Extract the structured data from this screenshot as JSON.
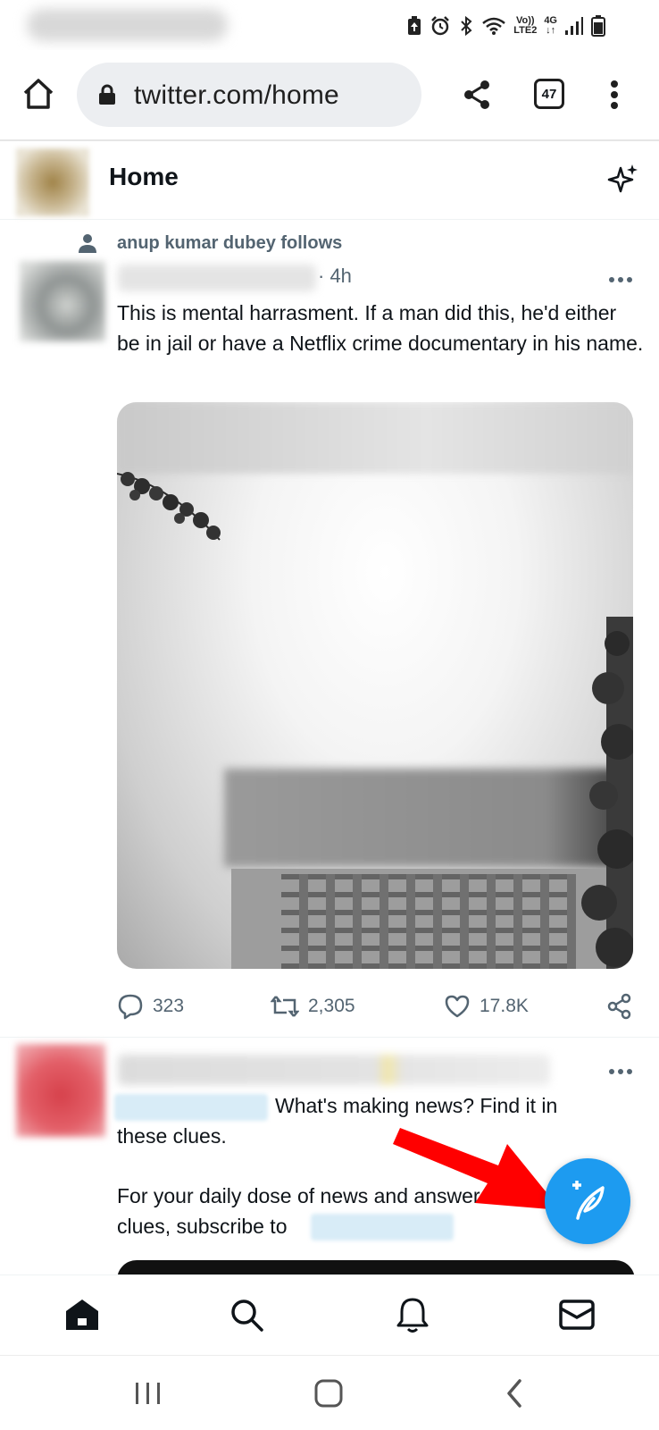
{
  "status_bar": {
    "network_top": "Vo))",
    "network_bottom": "LTE2",
    "data_top": "4G"
  },
  "browser": {
    "url": "twitter.com/home",
    "tab_count": "47"
  },
  "header": {
    "title": "Home"
  },
  "tweets": [
    {
      "social_context": "anup kumar dubey follows",
      "time": "· 4h",
      "text": "This is mental harrasment. If a man did this, he'd either be in jail or have a Netflix crime documentary in his name.",
      "replies": "323",
      "retweets": "2,305",
      "likes": "17.8K"
    },
    {
      "line1": "What's making news? Find it in",
      "line2": "these clues.",
      "line3": "For your daily dose of news and answer to t",
      "line4": "clues, subscribe to"
    }
  ],
  "colors": {
    "accent": "#1d9bf0",
    "secondary_text": "#536471",
    "arrow": "#ff0000"
  },
  "icons": [
    "home-icon",
    "lock-icon",
    "share-icon",
    "menu-icon",
    "sparkle-icon",
    "person-icon",
    "more-icon",
    "reply-icon",
    "retweet-icon",
    "like-icon",
    "share-tweet-icon",
    "compose-icon",
    "search-icon",
    "notifications-icon",
    "messages-icon",
    "recents-icon",
    "home-nav-icon",
    "back-icon"
  ]
}
